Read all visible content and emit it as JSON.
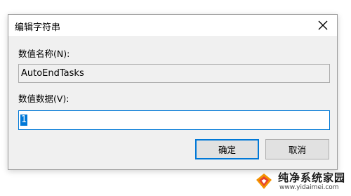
{
  "dialog": {
    "title": "编辑字符串",
    "value_name_label": "数值名称(N):",
    "value_name": "AutoEndTasks",
    "value_data_label": "数值数据(V):",
    "value_data": "1",
    "ok_label": "确定",
    "cancel_label": "取消"
  },
  "icons": {
    "close": "close-icon"
  },
  "watermark": {
    "brand": "纯净系统家园",
    "url": "www.yidaimei.com"
  },
  "colors": {
    "accent": "#0078d7",
    "dialog_bg": "#f0f0f0"
  }
}
